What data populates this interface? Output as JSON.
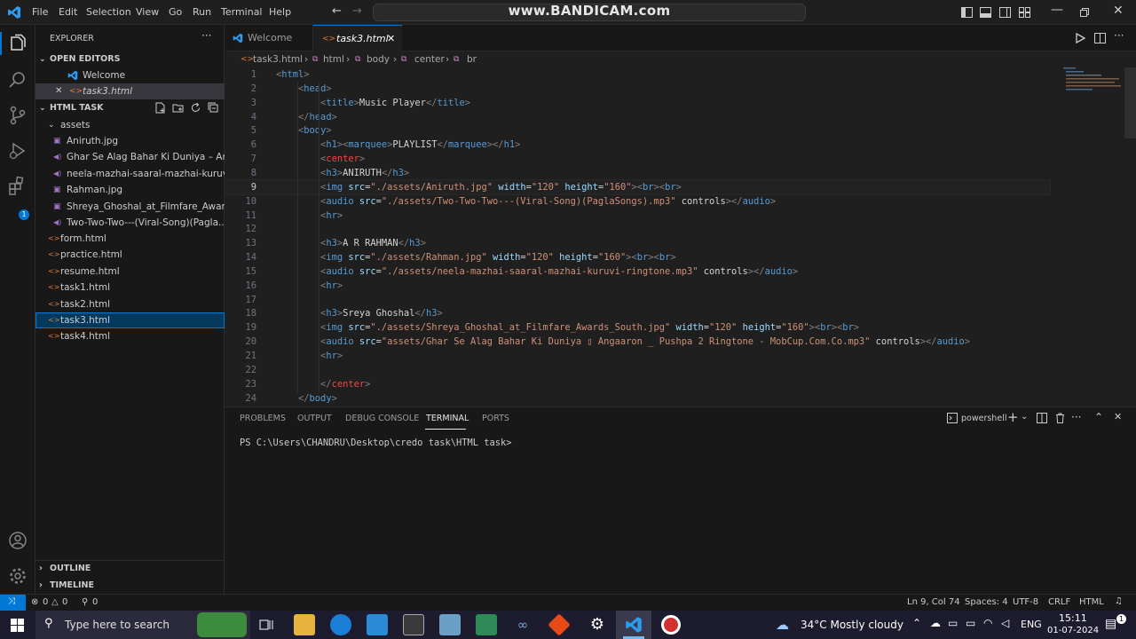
{
  "titlebar": {
    "menu": [
      "File",
      "Edit",
      "Selection",
      "View",
      "Go",
      "Run",
      "Terminal",
      "Help"
    ],
    "watermark": "www.BANDICAM.com"
  },
  "sidebar": {
    "title": "EXPLORER",
    "open_editors_label": "OPEN EDITORS",
    "open_editors": [
      "Welcome",
      "task3.html"
    ],
    "folder_label": "HTML TASK",
    "assets_label": "assets",
    "assets": [
      {
        "name": "Aniruth.jpg",
        "kind": "image"
      },
      {
        "name": "Ghar Se Alag Bahar Ki Duniya – An...",
        "kind": "audio"
      },
      {
        "name": "neela-mazhai-saaral-mazhai-kuruvi...",
        "kind": "audio"
      },
      {
        "name": "Rahman.jpg",
        "kind": "image"
      },
      {
        "name": "Shreya_Ghoshal_at_Filmfare_Award...",
        "kind": "image"
      },
      {
        "name": "Two-Two-Two---(Viral-Song)(Pagla...",
        "kind": "audio"
      }
    ],
    "files": [
      "form.html",
      "practice.html",
      "resume.html",
      "task1.html",
      "task2.html",
      "task3.html",
      "task4.html"
    ],
    "selected_file": "task3.html",
    "outline_label": "OUTLINE",
    "timeline_label": "TIMELINE"
  },
  "editor": {
    "tabs": [
      {
        "label": "Welcome",
        "active": false
      },
      {
        "label": "task3.html",
        "active": true
      }
    ],
    "breadcrumb": [
      "task3.html",
      "html",
      "body",
      "center",
      "br"
    ],
    "active_line": 9,
    "lines": [
      {
        "n": "1",
        "text": "<html>"
      },
      {
        "n": "2",
        "text": "    <head>"
      },
      {
        "n": "3",
        "text": "        <title>Music Player</title>"
      },
      {
        "n": "4",
        "text": "    </head>"
      },
      {
        "n": "5",
        "text": "    <body>"
      },
      {
        "n": "6",
        "text": "        <h1><marquee>PLAYLIST</marquee></h1>"
      },
      {
        "n": "7",
        "text": "        <center>"
      },
      {
        "n": "8",
        "text": "        <h3>ANIRUTH</h3>"
      },
      {
        "n": "9",
        "text": "        <img src=\"./assets/Aniruth.jpg\" width=\"120\" height=\"160\"><br><br>"
      },
      {
        "n": "10",
        "text": "        <audio src=\"./assets/Two-Two-Two---(Viral-Song)(PaglaSongs).mp3\" controls></audio>"
      },
      {
        "n": "11",
        "text": "        <hr>"
      },
      {
        "n": "12",
        "text": ""
      },
      {
        "n": "13",
        "text": "        <h3>A R RAHMAN</h3>"
      },
      {
        "n": "14",
        "text": "        <img src=\"./assets/Rahman.jpg\" width=\"120\" height=\"160\"><br><br>"
      },
      {
        "n": "15",
        "text": "        <audio src=\"./assets/neela-mazhai-saaral-mazhai-kuruvi-ringtone.mp3\" controls></audio>"
      },
      {
        "n": "16",
        "text": "        <hr>"
      },
      {
        "n": "17",
        "text": ""
      },
      {
        "n": "18",
        "text": "        <h3>Sreya Ghoshal</h3>"
      },
      {
        "n": "19",
        "text": "        <img src=\"./assets/Shreya_Ghoshal_at_Filmfare_Awards_South.jpg\" width=\"120\" height=\"160\"><br><br>"
      },
      {
        "n": "20",
        "text": "        <audio src=\"assets/Ghar Se Alag Bahar Ki Duniya ▯ Angaaron _ Pushpa 2 Ringtone - MobCup.Com.Co.mp3\" controls></audio>"
      },
      {
        "n": "21",
        "text": "        <hr>"
      },
      {
        "n": "22",
        "text": ""
      },
      {
        "n": "23",
        "text": "        </center>"
      },
      {
        "n": "24",
        "text": "    </body>"
      }
    ]
  },
  "panel": {
    "tabs": [
      "PROBLEMS",
      "OUTPUT",
      "DEBUG CONSOLE",
      "TERMINAL",
      "PORTS"
    ],
    "active_tab": "TERMINAL",
    "shell": "powershell",
    "prompt": "PS C:\\Users\\CHANDRU\\Desktop\\credo task\\HTML task>"
  },
  "statusbar": {
    "errors": "0",
    "warnings": "0",
    "ports": "0",
    "position": "Ln 9, Col 74",
    "spaces": "Spaces: 4",
    "encoding": "UTF-8",
    "eol": "CRLF",
    "language": "HTML"
  },
  "taskbar": {
    "search_placeholder": "Type here to search",
    "weather": "34°C  Mostly cloudy",
    "lang": "ENG",
    "time": "15:11",
    "date": "01-07-2024",
    "notification_count": "1"
  },
  "colors": {
    "accent": "#0078d4",
    "selection": "#04395e",
    "tag": "#569cd6",
    "attribute": "#9cdcfe",
    "string": "#ce9178"
  }
}
